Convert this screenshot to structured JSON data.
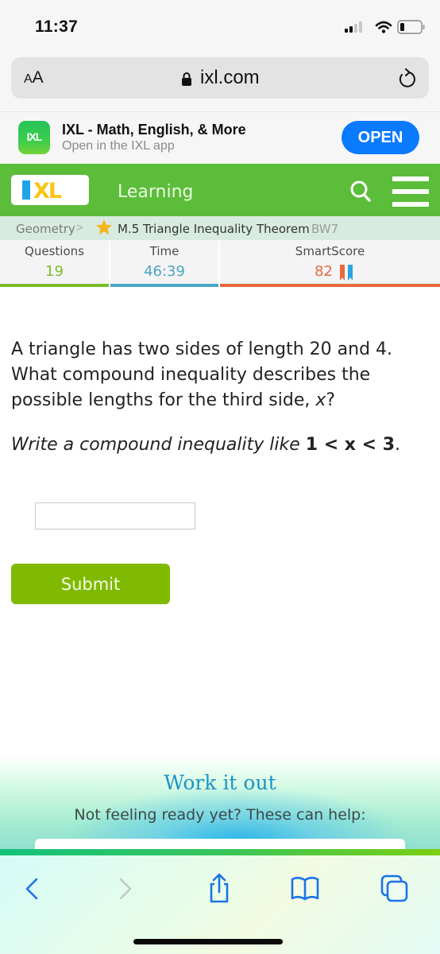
{
  "status_bar": {
    "time": "11:37"
  },
  "browser": {
    "text_size_label_small": "A",
    "text_size_label_large": "A",
    "url": "ixl.com"
  },
  "app_banner": {
    "icon_text": "IXL",
    "title": "IXL - Math, English, & More",
    "subtitle": "Open in the IXL app",
    "open_label": "OPEN"
  },
  "header": {
    "logo_text": "XL",
    "section": "Learning"
  },
  "breadcrumb": {
    "subject": "Geometry",
    "separator": ">",
    "skill": "M.5 Triangle Inequality Theorem",
    "code": "BW7"
  },
  "stats": {
    "questions_label": "Questions",
    "questions_value": "19",
    "time_label": "Time",
    "time_value": "46:39",
    "smartscore_label": "SmartScore",
    "smartscore_value": "82",
    "colors": {
      "questions": "#7cbc2c",
      "time": "#4aa5c6",
      "smartscore": "#e8693b"
    }
  },
  "question": {
    "text": "A triangle has two sides of length 20 and 4. What compound inequality describes the possible lengths for the third side, ",
    "variable": "x",
    "end": "?",
    "instruction_prefix": "Write a compound inequality like ",
    "instruction_example": "1 < x < 3",
    "instruction_suffix": "."
  },
  "answer": {
    "value": "",
    "placeholder": ""
  },
  "submit_label": "Submit",
  "work_it_out": {
    "title": "Work it out",
    "subtitle": "Not feeling ready yet? These can help:"
  },
  "toolbar": {
    "icons": [
      "back-icon",
      "forward-icon",
      "share-icon",
      "bookmarks-icon",
      "tabs-icon"
    ]
  }
}
